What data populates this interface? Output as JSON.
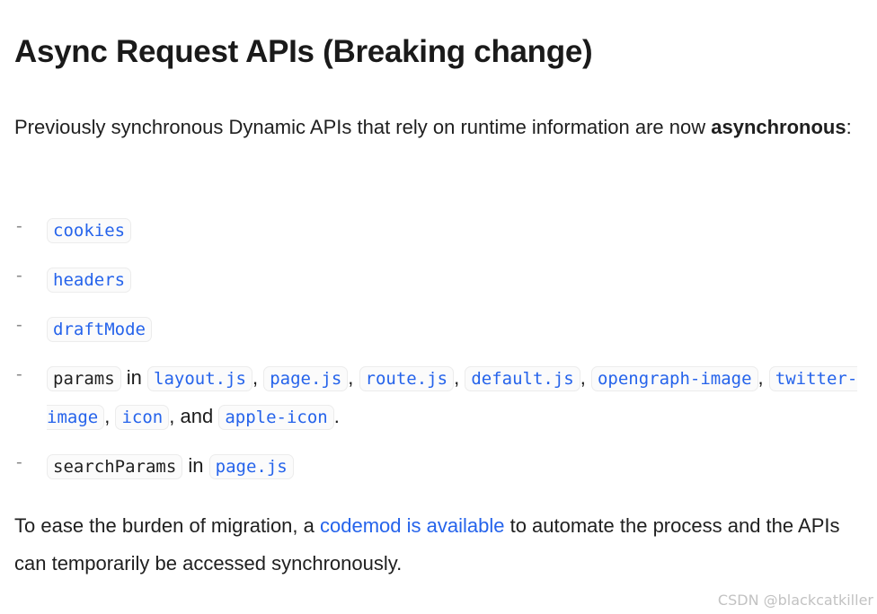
{
  "heading": "Async Request APIs (Breaking change)",
  "intro": {
    "text": "Previously synchronous Dynamic APIs that rely on runtime information are now ",
    "bold": "asynchronous",
    "after": ":"
  },
  "list": {
    "dash": "-",
    "items": [
      {
        "code": "cookies"
      },
      {
        "code": "headers"
      },
      {
        "code": "draftMode"
      },
      {
        "code": "params",
        "in": "in",
        "files": [
          "layout.js",
          "page.js",
          "route.js",
          "default.js",
          "opengraph-image",
          "twitter-image",
          "icon"
        ],
        "comma": ",",
        "and": "and",
        "last": "apple-icon",
        "period": "."
      },
      {
        "code": "searchParams",
        "in": "in",
        "file": "page.js"
      }
    ]
  },
  "outro": {
    "before": "To ease the burden of migration, a ",
    "link": "codemod is available",
    "after": " to automate the process and the APIs can temporarily be accessed synchronously."
  },
  "watermark": "CSDN @blackcatkiller",
  "colors": {
    "link": "#2563eb",
    "text": "#1f1f1f",
    "code_bg": "#fbfbfb",
    "code_border": "#ececec"
  }
}
